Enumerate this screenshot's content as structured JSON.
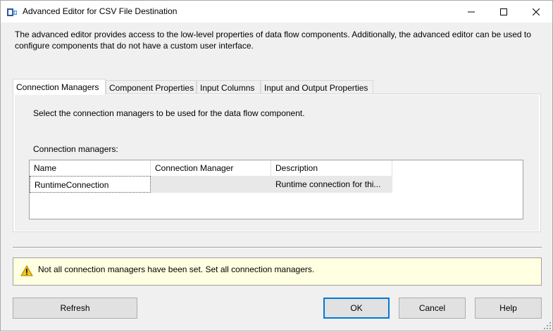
{
  "window": {
    "title": "Advanced Editor for CSV File Destination",
    "icon": "ssis-destination-icon"
  },
  "intro": "The advanced editor provides access to the low-level properties of data flow components. Additionally, the advanced editor can be used to configure components that do not have a custom user interface.",
  "tabs": [
    {
      "label": "Connection Managers",
      "active": true
    },
    {
      "label": "Component Properties",
      "active": false
    },
    {
      "label": "Input Columns",
      "active": false
    },
    {
      "label": "Input and Output Properties",
      "active": false
    }
  ],
  "panel": {
    "instruction": "Select the connection managers to be used for the data flow component.",
    "list_label": "Connection managers:"
  },
  "grid": {
    "columns": [
      "Name",
      "Connection Manager",
      "Description"
    ],
    "rows": [
      {
        "name": "RuntimeConnection",
        "connection_manager": "",
        "description": "Runtime connection for thi..."
      }
    ]
  },
  "warning": {
    "icon": "warning-icon",
    "text": "Not all connection managers have been set. Set all connection managers."
  },
  "buttons": {
    "refresh": "Refresh",
    "ok": "OK",
    "cancel": "Cancel",
    "help": "Help"
  },
  "colors": {
    "warning_bg": "#ffffe1",
    "default_button_border": "#0078d7",
    "warning_icon": "#f6c514"
  }
}
